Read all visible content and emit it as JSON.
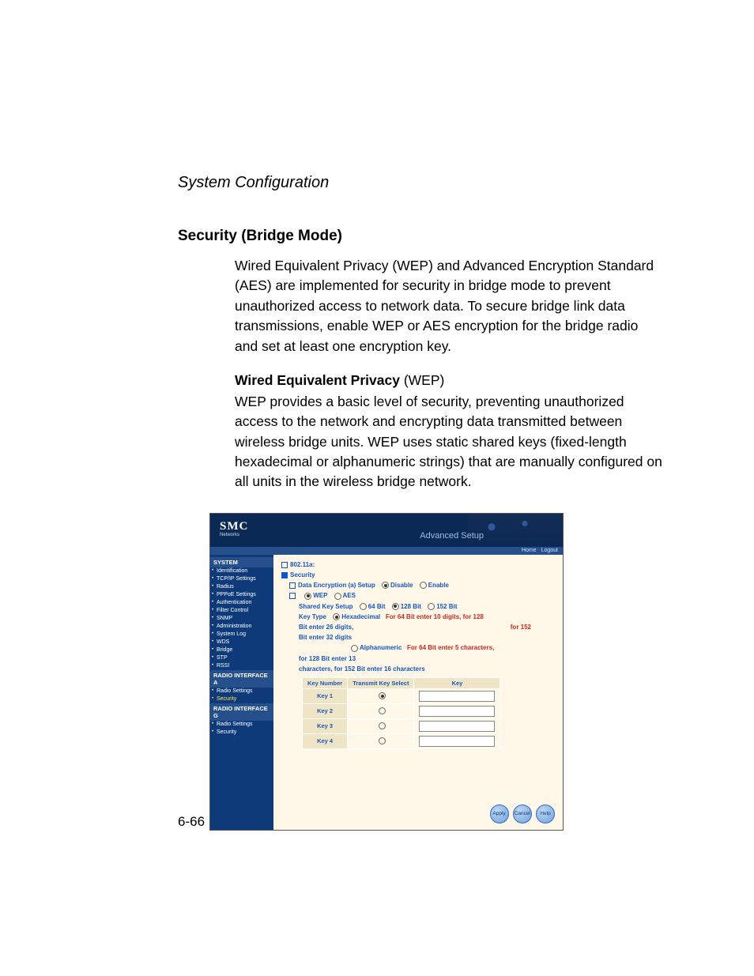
{
  "doc": {
    "running_head": "System Configuration",
    "section_title": "Security (Bridge Mode)",
    "para1": "Wired Equivalent Privacy (WEP) and Advanced Encryption Standard (AES) are implemented for security in bridge mode to prevent unauthorized access to network data. To secure bridge link data transmissions, enable WEP or AES  encryption for the bridge radio and set at least one encryption key.",
    "sub_head_bold": "Wired Equivalent Privacy",
    "sub_head_rest": " (WEP)",
    "para2": "WEP provides a basic level of security, preventing unauthorized access to the network and encrypting data transmitted between wireless bridge units. WEP uses static shared keys (fixed-length hexadecimal or alphanumeric strings) that are manually configured on all units in the wireless bridge network.",
    "page_num": "6-66"
  },
  "shot": {
    "brand": "SMC",
    "brand_sub": "Networks",
    "adv": "Advanced Setup",
    "topbar": {
      "home": "Home",
      "logout": "Logout"
    },
    "nav": {
      "system_head": "SYSTEM",
      "system_items": [
        "Identification",
        "TCP/IP Settings",
        "Radius",
        "PPPoE Settings",
        "Authentication",
        "Filter Control",
        "SNMP",
        "Administration",
        "System Log",
        "WDS",
        "Bridge",
        "STP",
        "RSSI"
      ],
      "ria_head": "RADIO INTERFACE A",
      "ria_items": [
        "Radio Settings",
        "Security"
      ],
      "ria_hl_index": 1,
      "rig_head": "RADIO INTERFACE G",
      "rig_items": [
        "Radio Settings",
        "Security"
      ]
    },
    "main": {
      "band": "802.11a:",
      "security": "Security",
      "data_enc_label": "Data Encryption (a) Setup",
      "disable": "Disable",
      "enable": "Enable",
      "wep": "WEP",
      "aes": "AES",
      "shared_key_label": "Shared Key Setup",
      "sk_64": "64 Bit",
      "sk_128": "128 Bit",
      "sk_152": "152 Bit",
      "key_type_label": "Key Type",
      "hex_label": "Hexadecimal",
      "hex_note_a": "For 64 Bit enter 10 digits, for 128",
      "hex_note_b": "Bit enter 26 digits,",
      "hex_note_c": "for 152",
      "hex_note_d": "Bit enter 32 digits",
      "alpha_label": "Alphanumeric",
      "alpha_note_a": "For 64 Bit enter 5 characters,",
      "alpha_note_b": "for 128 Bit enter 13",
      "alpha_note_c": "characters, for 152 Bit enter 16 characters",
      "table": {
        "h_num": "Key Number",
        "h_tx": "Transmit Key Select",
        "h_key": "Key",
        "rows": [
          "Key 1",
          "Key 2",
          "Key 3",
          "Key 4"
        ]
      },
      "buttons": {
        "apply": "Apply",
        "cancel": "Cancel",
        "help": "Help"
      }
    }
  }
}
